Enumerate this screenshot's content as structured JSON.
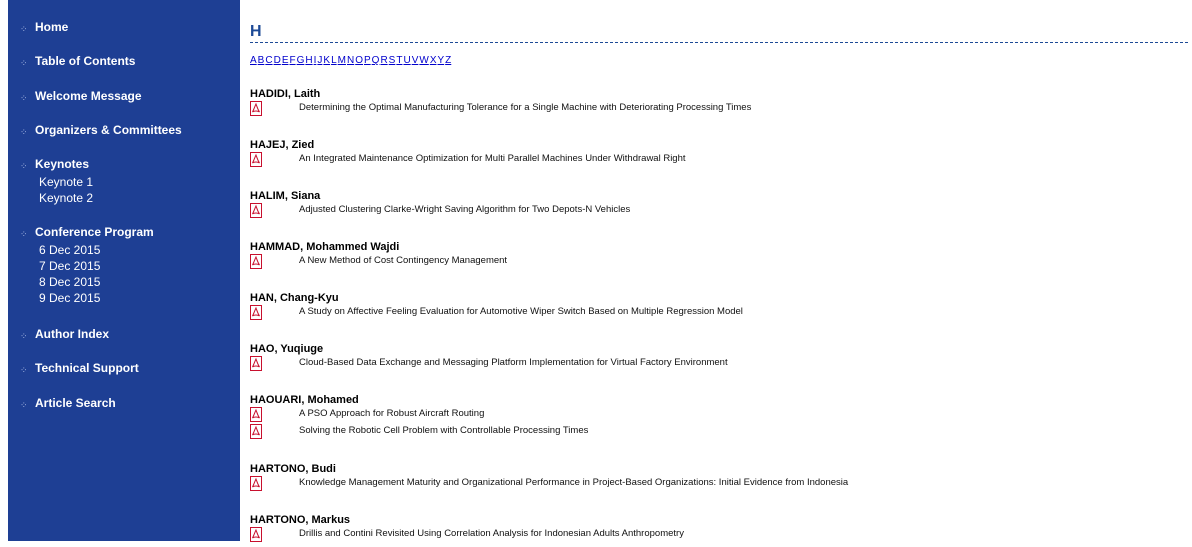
{
  "sidebar": {
    "items": [
      {
        "label": "Home"
      },
      {
        "label": "Table of Contents"
      },
      {
        "label": "Welcome Message"
      },
      {
        "label": "Organizers & Committees"
      },
      {
        "label": "Keynotes",
        "children": [
          "Keynote 1",
          "Keynote 2"
        ]
      },
      {
        "label": "Conference Program",
        "children": [
          "6 Dec 2015",
          "7 Dec 2015",
          "8 Dec 2015",
          "9 Dec 2015"
        ]
      },
      {
        "label": "Author Index"
      },
      {
        "label": "Technical Support"
      },
      {
        "label": "Article Search"
      }
    ]
  },
  "main": {
    "heading": "H",
    "letters": [
      "A",
      "B",
      "C",
      "D",
      "E",
      "F",
      "G",
      "H",
      "I",
      "J",
      "K",
      "L",
      "M",
      "N",
      "O",
      "P",
      "Q",
      "R",
      "S",
      "T",
      "U",
      "V",
      "W",
      "X",
      "Y",
      "Z"
    ],
    "authors": [
      {
        "name": "HADIDI, Laith",
        "papers": [
          "Determining the Optimal Manufacturing Tolerance for a Single Machine with Deteriorating Processing Times"
        ]
      },
      {
        "name": "HAJEJ, Zied",
        "papers": [
          "An Integrated Maintenance Optimization for Multi Parallel Machines Under Withdrawal Right"
        ]
      },
      {
        "name": "HALIM, Siana",
        "papers": [
          "Adjusted Clustering Clarke-Wright Saving Algorithm for Two Depots-N Vehicles"
        ]
      },
      {
        "name": "HAMMAD, Mohammed Wajdi",
        "papers": [
          "A New Method of Cost Contingency Management"
        ]
      },
      {
        "name": "HAN, Chang-Kyu",
        "papers": [
          "A Study on Affective Feeling Evaluation for Automotive Wiper Switch Based on Multiple Regression Model"
        ]
      },
      {
        "name": "HAO, Yuqiuge",
        "papers": [
          "Cloud-Based Data Exchange and Messaging Platform Implementation for Virtual Factory Environment"
        ]
      },
      {
        "name": "HAOUARI, Mohamed",
        "papers": [
          "A PSO Approach for Robust Aircraft Routing",
          "Solving the Robotic Cell Problem with Controllable Processing Times"
        ]
      },
      {
        "name": "HARTONO, Budi",
        "papers": [
          "Knowledge Management Maturity and Organizational Performance in Project-Based Organizations: Initial Evidence from Indonesia"
        ]
      },
      {
        "name": "HARTONO, Markus",
        "papers": [
          "Drillis and Contini Revisited Using Correlation Analysis for Indonesian Adults Anthropometry"
        ]
      }
    ]
  }
}
